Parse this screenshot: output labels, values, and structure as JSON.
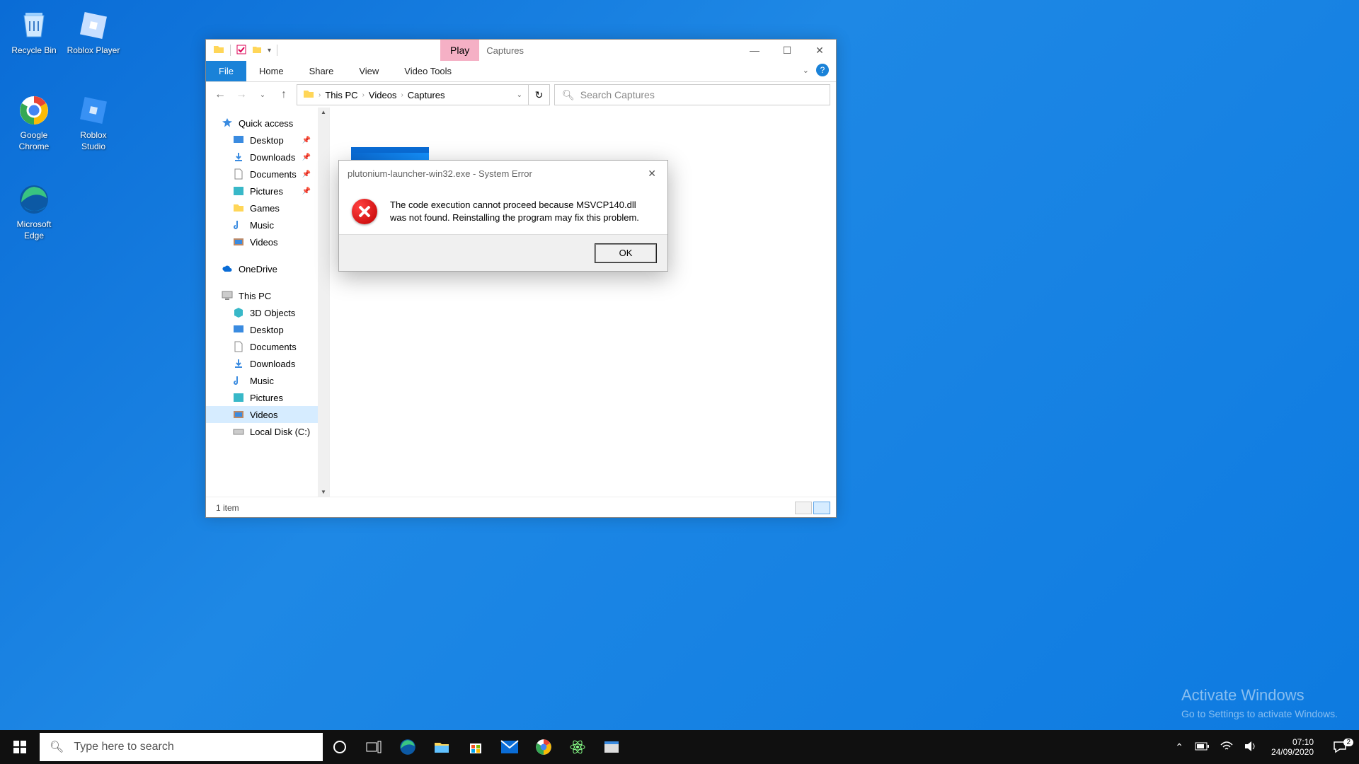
{
  "desktop": {
    "icons": [
      {
        "name": "recycle-bin",
        "label": "Recycle Bin"
      },
      {
        "name": "roblox-player",
        "label": "Roblox Player"
      },
      {
        "name": "google-chrome",
        "label": "Google\nChrome"
      },
      {
        "name": "roblox-studio",
        "label": "Roblox\nStudio"
      },
      {
        "name": "microsoft-edge",
        "label": "Microsoft\nEdge"
      }
    ]
  },
  "explorer": {
    "window_title": "Captures",
    "contextual_tab": "Play",
    "ribbon": {
      "file": "File",
      "home": "Home",
      "share": "Share",
      "view": "View",
      "video_tools": "Video Tools"
    },
    "nav": {
      "breadcrumb": [
        "This PC",
        "Videos",
        "Captures"
      ]
    },
    "search_placeholder": "Search Captures",
    "sidebar": {
      "quick_access": "Quick access",
      "quick_items": [
        {
          "label": "Desktop",
          "pinned": true
        },
        {
          "label": "Downloads",
          "pinned": true
        },
        {
          "label": "Documents",
          "pinned": true
        },
        {
          "label": "Pictures",
          "pinned": true
        },
        {
          "label": "Games",
          "pinned": false
        },
        {
          "label": "Music",
          "pinned": false
        },
        {
          "label": "Videos",
          "pinned": false
        }
      ],
      "onedrive": "OneDrive",
      "this_pc": "This PC",
      "pc_items": [
        "3D Objects",
        "Desktop",
        "Documents",
        "Downloads",
        "Music",
        "Pictures",
        "Videos",
        "Local Disk (C:)"
      ]
    },
    "status_text": "1 item"
  },
  "dialog": {
    "title": "plutonium-launcher-win32.exe - System Error",
    "message": "The code execution cannot proceed because MSVCP140.dll was not found. Reinstalling the program may fix this problem.",
    "ok": "OK"
  },
  "watermark": {
    "heading": "Activate Windows",
    "subtext": "Go to Settings to activate Windows."
  },
  "taskbar": {
    "search_placeholder": "Type here to search",
    "time": "07:10",
    "date": "24/09/2020",
    "notif_count": "2"
  }
}
